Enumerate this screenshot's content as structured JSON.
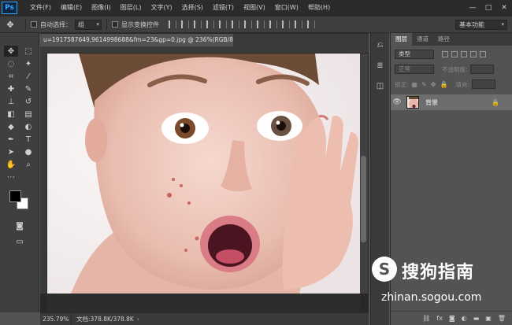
{
  "app": {
    "logo": "Ps"
  },
  "menu": [
    "文件(F)",
    "编辑(E)",
    "图像(I)",
    "图层(L)",
    "文字(Y)",
    "选择(S)",
    "滤镜(T)",
    "视图(V)",
    "窗口(W)",
    "帮助(H)"
  ],
  "window_controls": {
    "minimize": "—",
    "restore": "□",
    "close": "✕"
  },
  "options": {
    "auto_select_label": "自动选择：",
    "auto_select_value": "组",
    "show_transform_label": "显示变换控件",
    "workspace": "基本功能"
  },
  "document": {
    "tab_title": "u=1917587649,9614998688&fm=23&gp=0.jpg @ 236%(RGB/8#)",
    "close": "×"
  },
  "status": {
    "zoom": "235.79%",
    "doc_info": "文档:378.8K/378.8K"
  },
  "layers_panel": {
    "tabs": [
      "图层",
      "通道",
      "路径"
    ],
    "kind": "类型",
    "blend_mode": "正常",
    "opacity_label": "不透明度:",
    "lock_label": "锁定:",
    "fill_label": "填充:",
    "layer_name": "背景"
  },
  "watermark": {
    "logo": "S",
    "text": "搜狗指南",
    "url": "zhinan.sogou.com"
  },
  "colors": {
    "accent": "#31a8ff",
    "fg": "#000000",
    "bg": "#ffffff"
  }
}
